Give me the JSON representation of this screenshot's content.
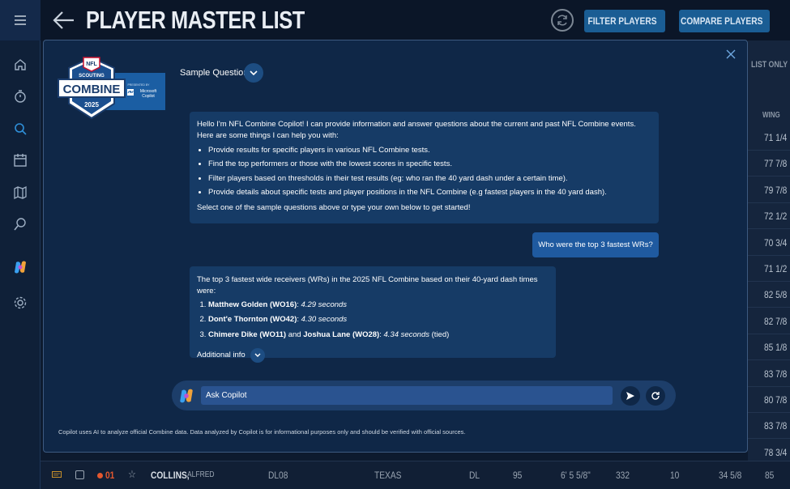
{
  "header": {
    "title": "PLAYER MASTER LIST",
    "filter_label": "FILTER PLAYERS",
    "compare_label": "COMPARE PLAYERS"
  },
  "sidebar": {
    "items": [
      "menu-icon",
      "home-icon",
      "stopwatch-icon",
      "player-search-icon",
      "calendar-icon",
      "map-icon",
      "search-icon",
      "copilot-icon",
      "settings-icon"
    ]
  },
  "background": {
    "list_only": "LIST ONLY",
    "wing_header": "WING",
    "wing_values": [
      "71 1/4",
      "77 7/8",
      "79 7/8",
      "72 1/2",
      "70 3/4",
      "71 1/2",
      "82 5/8",
      "82 7/8",
      "85 1/8",
      "83 7/8",
      "80 7/8",
      "83 7/8",
      "78 3/4"
    ],
    "bottom_row": {
      "number": "01",
      "name_last": "COLLINS,",
      "name_first": "ALFRED",
      "code": "DL08",
      "school": "TEXAS",
      "position": "DL",
      "grade": "95",
      "height": "6' 5 5/8\"",
      "weight": "332",
      "hand": "10",
      "arm": "34 5/8",
      "wing": "85"
    }
  },
  "copilot": {
    "sample_questions_label": "Sample Questions",
    "intro": "Hello I'm NFL Combine Copilot! I can provide information and answer questions about the current and past NFL Combine events. Here are some things I can help you with:",
    "capabilities": [
      "Provide results for specific players in various NFL Combine tests.",
      "Find the top performers or those with the lowest scores in specific tests.",
      "Filter players based on thresholds in their test results (eg: who ran the 40 yard dash under a certain time).",
      "Provide details about specific tests and player positions in the NFL Combine (e.g fastest players in the 40 yard dash)."
    ],
    "intro_footer": "Select one of the sample questions above or type your own below to get started!",
    "user_question": "Who were the top 3 fastest WRs?",
    "answer_intro": "The top 3 fastest wide receivers (WRs) in the 2025 NFL Combine based on their 40-yard dash times were:",
    "answers": [
      {
        "name": "Matthew Golden (WO16)",
        "time": "4.29 seconds",
        "suffix": ""
      },
      {
        "name": "Dont'e Thornton (WO42)",
        "time": "4.30 seconds",
        "suffix": ""
      },
      {
        "name": "Chimere Dike (WO11)",
        "joiner": " and ",
        "name2": "Joshua Lane (WO28)",
        "time": "4.34 seconds",
        "suffix": " (tied)"
      }
    ],
    "additional_info": "Additional info",
    "input_placeholder": "Ask Copilot",
    "disclaimer": "Copilot uses AI to analyze official Combine data. Data analyzed by Copilot is for informational purposes only and should be verified with official sources."
  },
  "logo": {
    "nfl": "NFL",
    "scouting": "SCOUTING",
    "combine": "COMBINE",
    "year": "2025",
    "presented_by": "PRESENTED BY",
    "sponsor_line1": "Microsoft",
    "sponsor_line2": "Copilot"
  }
}
